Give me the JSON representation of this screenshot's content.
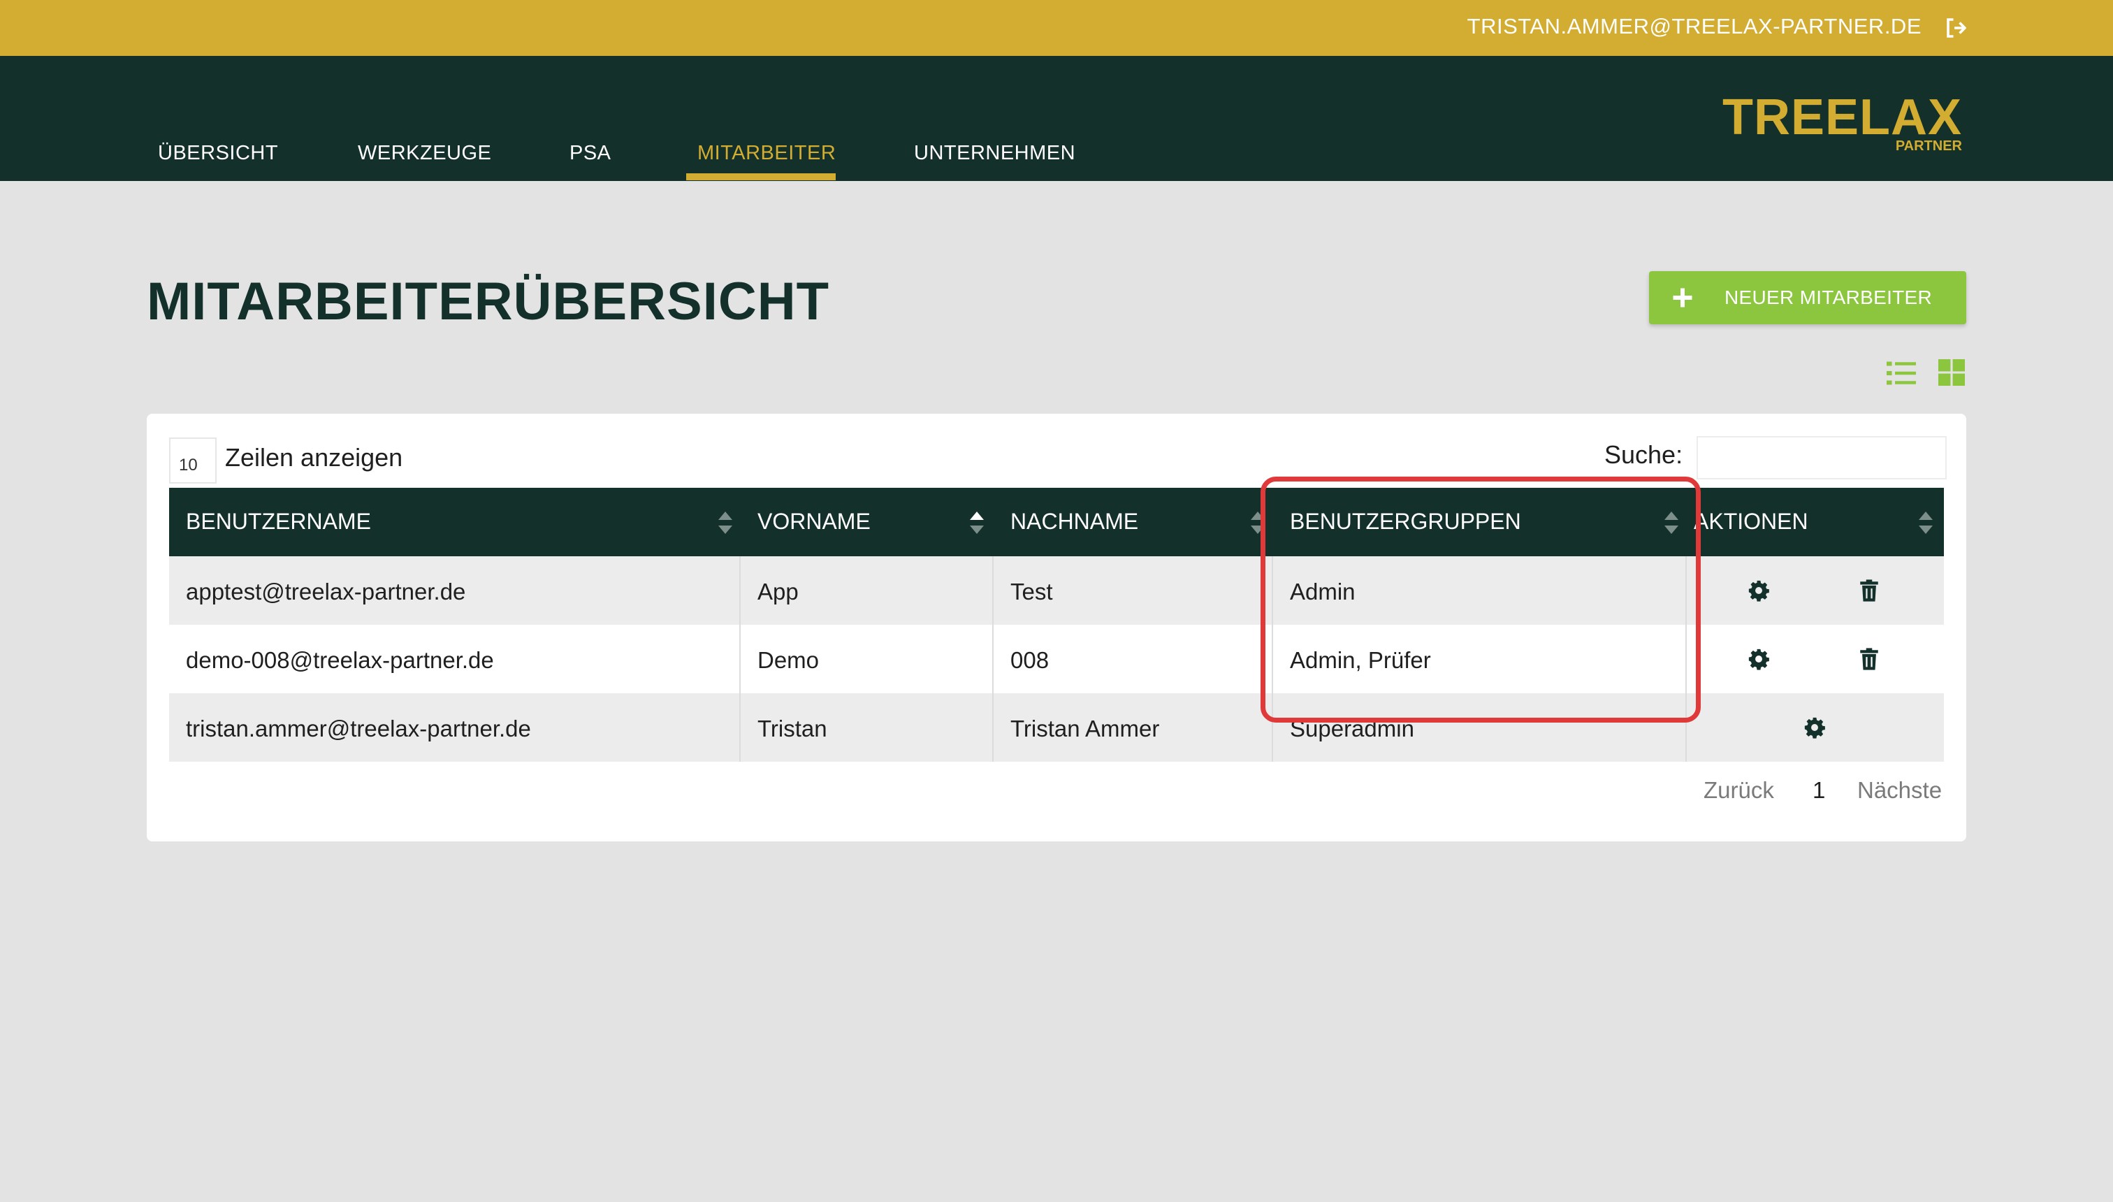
{
  "header": {
    "user_email": "TRISTAN.AMMER@TREELAX-PARTNER.DE",
    "logout_icon": "sign-out-icon"
  },
  "nav": {
    "items": [
      {
        "label": "ÜBERSICHT",
        "active": false
      },
      {
        "label": "WERKZEUGE",
        "active": false
      },
      {
        "label": "PSA",
        "active": false
      },
      {
        "label": "MITARBEITER",
        "active": true
      },
      {
        "label": "UNTERNEHMEN",
        "active": false
      }
    ]
  },
  "logo": {
    "main": "TREELAX",
    "sub": "PARTNER"
  },
  "page": {
    "title": "MITARBEITERÜBERSICHT",
    "new_button_label": "NEUER MITARBEITER",
    "view_icons": [
      "list-view-icon",
      "grid-view-icon"
    ]
  },
  "table": {
    "page_length": "10",
    "page_length_label": "Zeilen anzeigen",
    "search_label": "Suche:",
    "search_value": "",
    "columns": [
      "BENUTZERNAME",
      "VORNAME",
      "NACHNAME",
      "BENUTZERGRUPPEN",
      "AKTIONEN"
    ],
    "rows": [
      {
        "username": "apptest@treelax-partner.de",
        "firstname": "App",
        "lastname": "Test",
        "groups": "Admin",
        "actions": [
          "gear-icon",
          "trash-icon"
        ]
      },
      {
        "username": "demo-008@treelax-partner.de",
        "firstname": "Demo",
        "lastname": "008",
        "groups": "Admin, Prüfer",
        "actions": [
          "gear-icon",
          "trash-icon"
        ]
      },
      {
        "username": "tristan.ammer@treelax-partner.de",
        "firstname": "Tristan",
        "lastname": "Tristan Ammer",
        "groups": "Superadmin",
        "actions": [
          "gear-icon"
        ]
      }
    ],
    "pagination": {
      "prev": "Zurück",
      "current": "1",
      "next": "Nächste"
    }
  },
  "colors": {
    "gold": "#d3ad31",
    "dark_green": "#13302b",
    "lime": "#8cc63f",
    "highlight": "#e0393a"
  }
}
